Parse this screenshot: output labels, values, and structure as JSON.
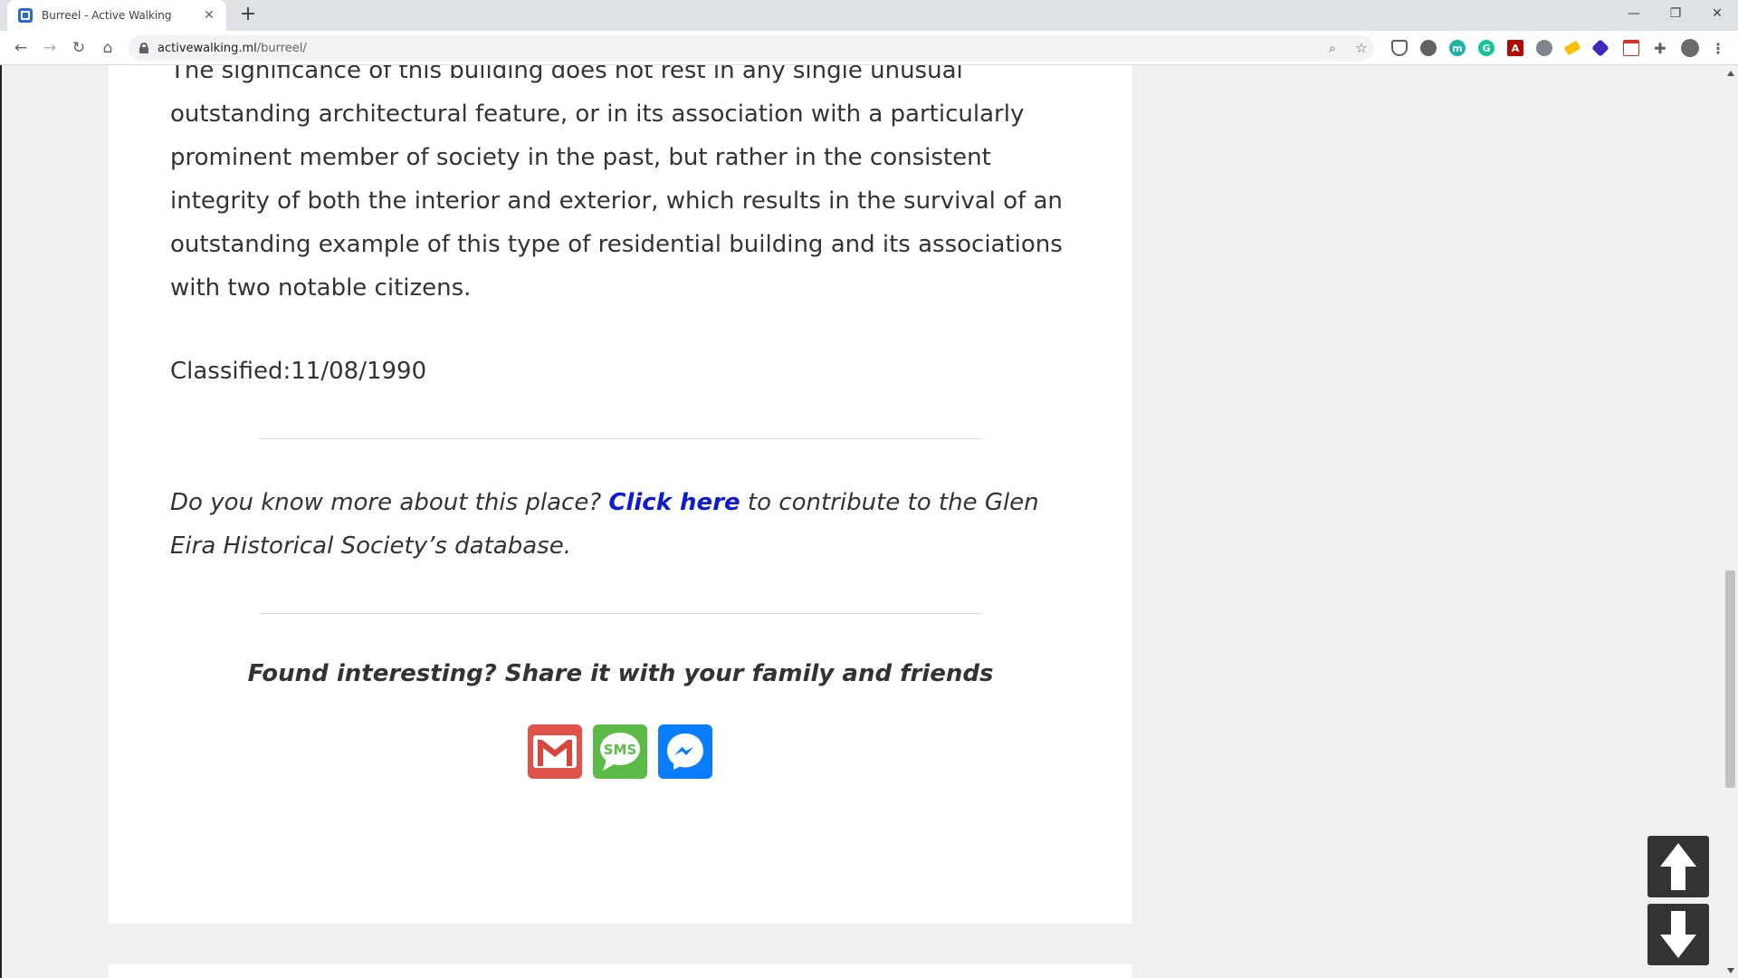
{
  "browser": {
    "tab_title": "Burreel - Active Walking",
    "url_host": "activewalking.ml",
    "url_path": "/burreel/"
  },
  "article": {
    "paragraph": "The significance of this building does not rest in any single unusual outstanding architectural feature, or in its association with a particularly prominent member of society in the past, but rather in the consistent integrity of both the interior and exterior, which results in the survival of an outstanding example of this type of residential building and its associations with two notable citizens.",
    "classified": "Classified:11/08/1990",
    "contribute_before": "Do you know more about this place? ",
    "contribute_link": "Click here",
    "contribute_after": " to contribute to the Glen Eira Historical Society’s database.",
    "share_heading": "Found interesting? Share it with your family and friends",
    "sms_label": "SMS"
  },
  "icons": {
    "gmail": "gmail-icon",
    "sms": "sms-icon",
    "messenger": "messenger-icon",
    "up": "arrow-up-icon",
    "down": "arrow-down-icon"
  },
  "colors": {
    "link": "#0d1bd6",
    "gmail": "#e0534a",
    "sms": "#5cba47",
    "messenger": "#0a7cff",
    "float_btn": "#333333"
  }
}
